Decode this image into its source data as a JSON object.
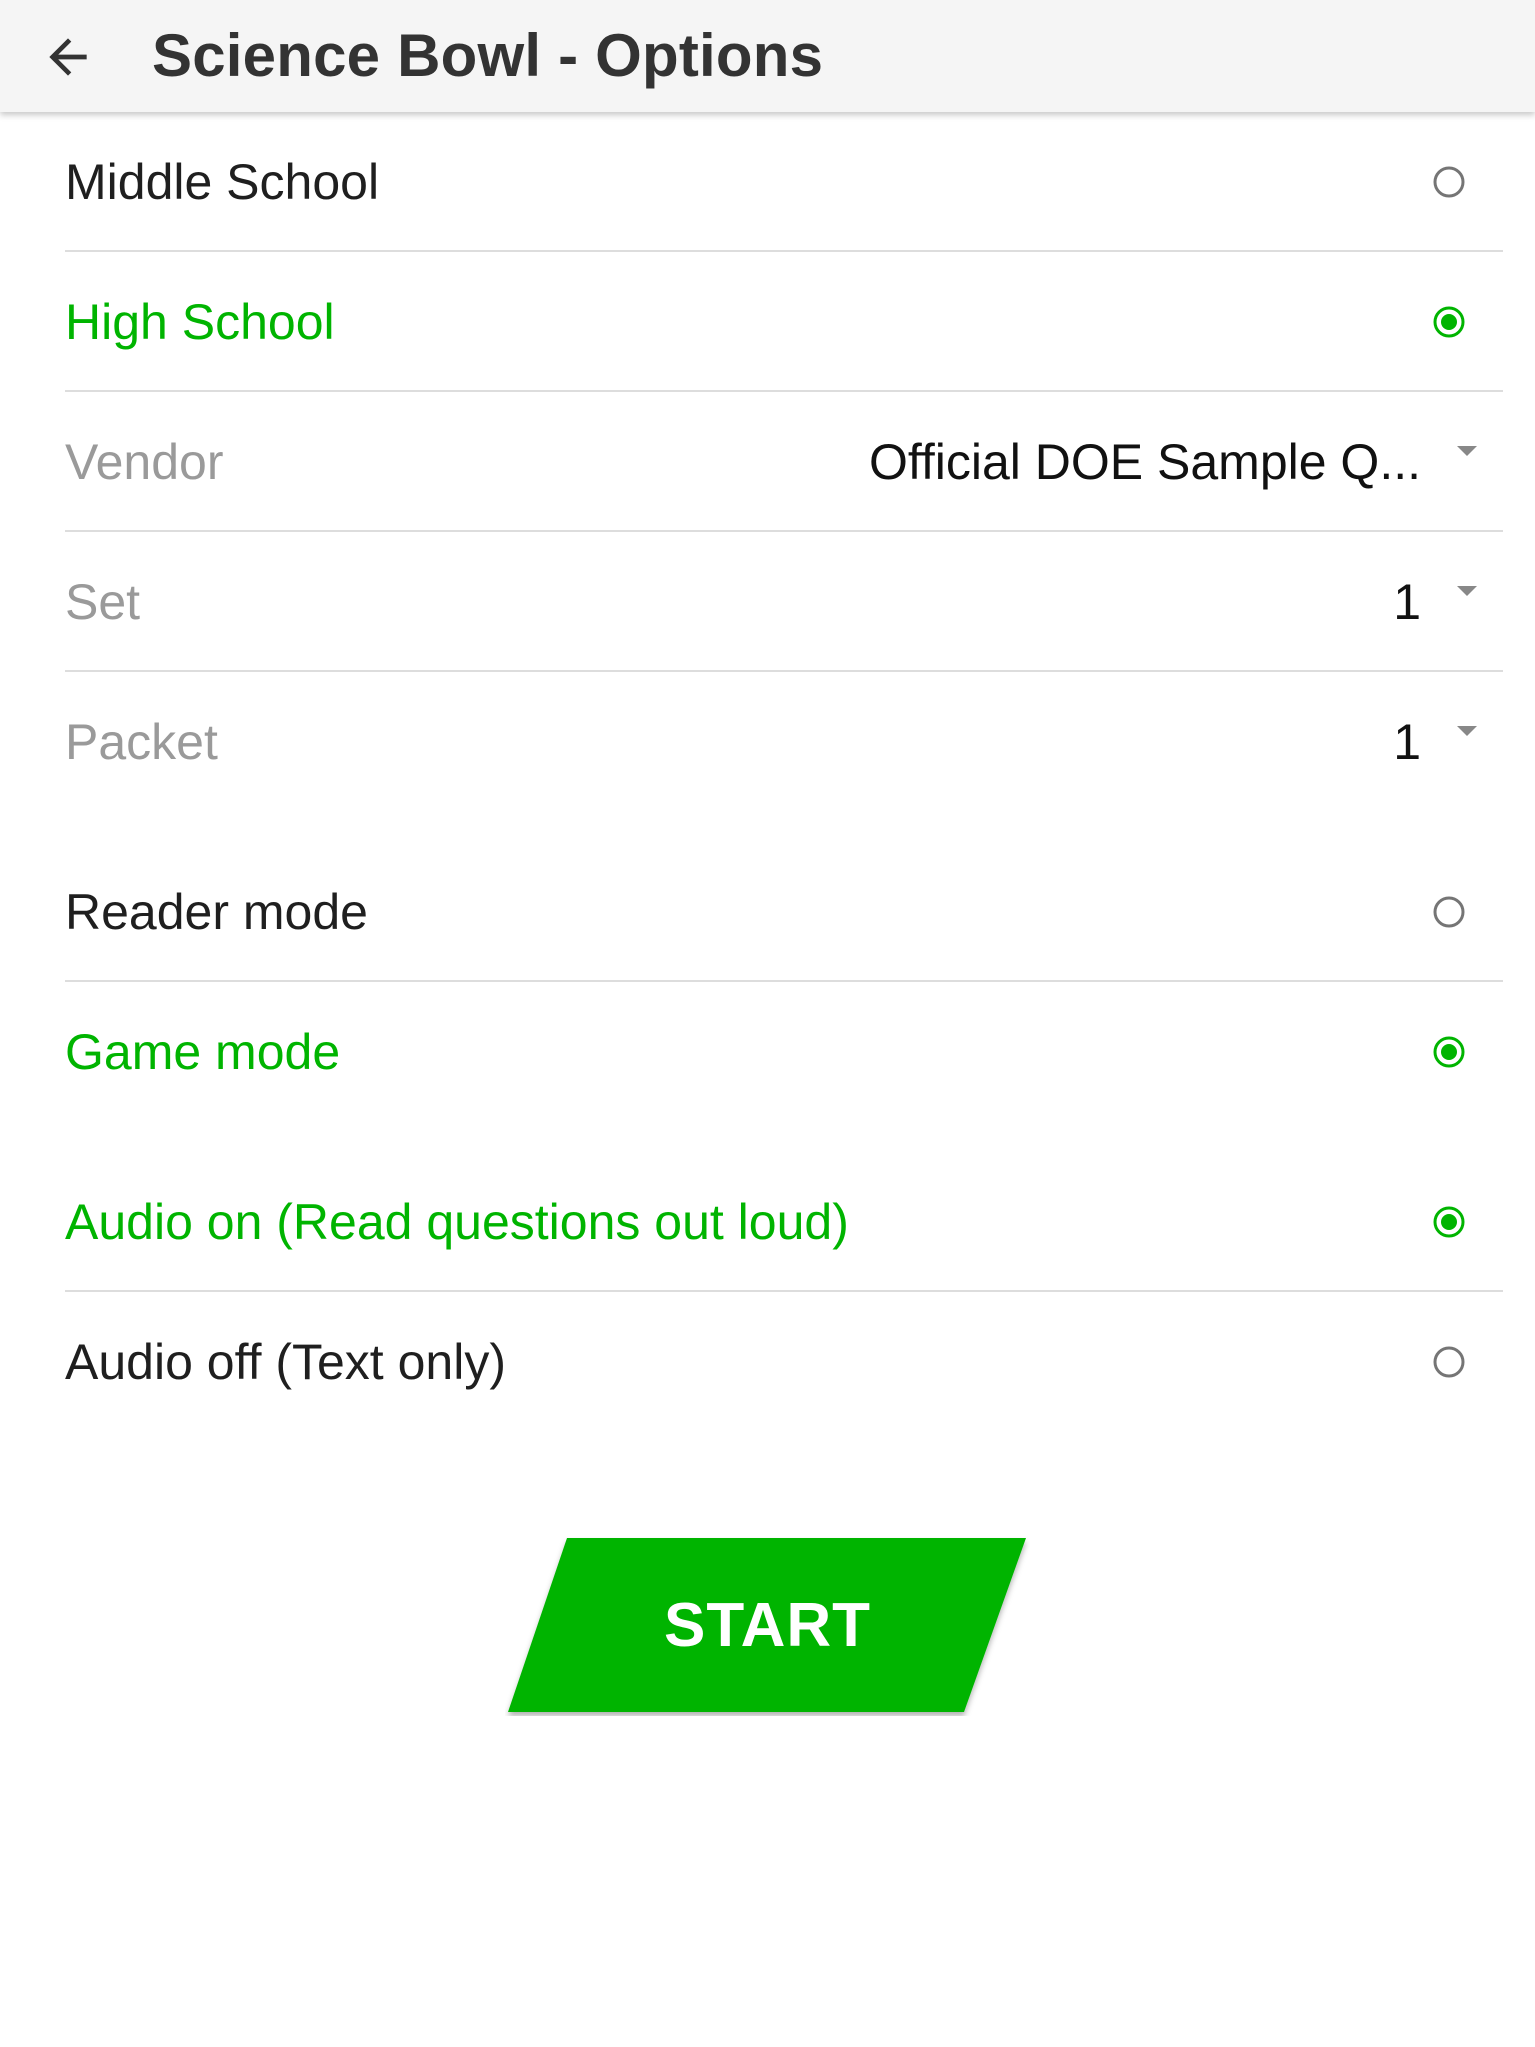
{
  "appbar": {
    "title": "Science Bowl - Options",
    "back_icon": "arrow-left-icon"
  },
  "colors": {
    "accent": "#00b400",
    "label": "#1f1f1f",
    "field_label": "#9a9a9a",
    "divider": "#dddddd",
    "radio_off": "#757575"
  },
  "level": {
    "options": [
      {
        "label": "Middle School",
        "selected": false
      },
      {
        "label": "High School",
        "selected": true
      }
    ]
  },
  "fields": {
    "vendor": {
      "label": "Vendor",
      "value": "Official DOE Sample Q..."
    },
    "set": {
      "label": "Set",
      "value": "1"
    },
    "packet": {
      "label": "Packet",
      "value": "1"
    }
  },
  "mode": {
    "options": [
      {
        "label": "Reader mode",
        "selected": false
      },
      {
        "label": "Game mode",
        "selected": true
      }
    ]
  },
  "audio": {
    "options": [
      {
        "label": "Audio on (Read questions out loud)",
        "selected": true
      },
      {
        "label": "Audio off (Text only)",
        "selected": false
      }
    ]
  },
  "start_button": {
    "label": "START"
  }
}
